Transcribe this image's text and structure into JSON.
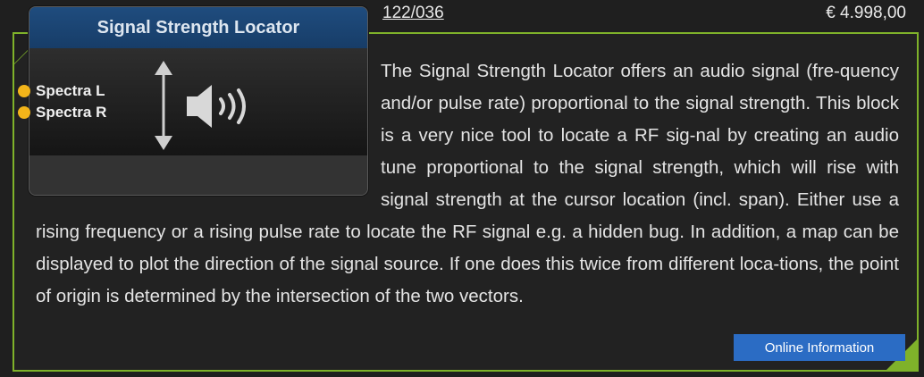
{
  "product": {
    "article_number": "122/036",
    "price": "€ 4.998,00"
  },
  "block": {
    "title": "Signal Strength Locator",
    "ports": [
      {
        "label": "Spectra L",
        "color": "#f3b51a"
      },
      {
        "label": "Spectra R",
        "color": "#f3b51a"
      }
    ],
    "icons": [
      "up-down-arrow-icon",
      "speaker-icon"
    ]
  },
  "description": "The Signal Strength Locator offers an audio signal (fre-quency and/or pulse rate) proportional to the signal strength. This block is a very nice tool to locate a RF sig-nal by creating an audio tune proportional to the signal strength, which will rise with signal strength at the cursor location (incl. span). Either use a rising frequency or a rising pulse rate to locate the RF signal e.g. a hidden bug. In addition, a map can be displayed to plot the direction of the signal source. If one does this twice from different loca-tions, the point of origin is determined by the intersection of the two vectors.",
  "online_info_label": "Online Information",
  "colors": {
    "frame": "#7fb22a",
    "header": "#1f4c7e",
    "button": "#2b6cc4",
    "port": "#f3b51a"
  }
}
